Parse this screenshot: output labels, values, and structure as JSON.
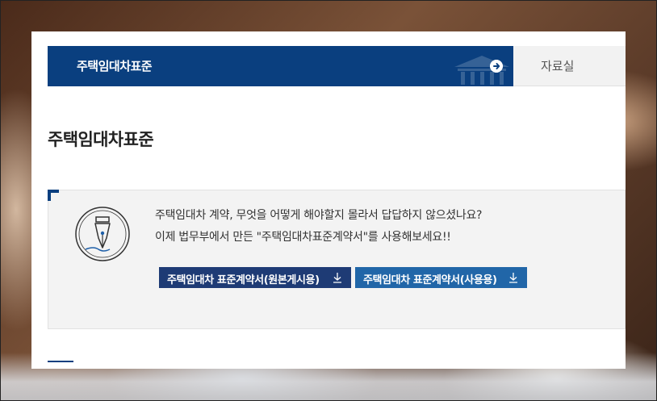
{
  "tabs": {
    "active_label": "주택임대차표준",
    "inactive_label": "자료실"
  },
  "page": {
    "title": "주택임대차표준"
  },
  "info": {
    "line1": "주택임대차 계약, 무엇을 어떻게 해야할지 몰라서 답답하지 않으셨나요?",
    "line2": "이제 법무부에서 만든 \"주택임대차표준계약서\"를 사용해보세요!!"
  },
  "downloads": {
    "original_label": "주택임대차 표준계약서(원본게시용)",
    "user_label": "주택임대차 표준계약서(사용용)"
  },
  "icons": {
    "arrow": "arrow-right-circle-icon",
    "bank": "bank-building-icon",
    "pen": "fountain-pen-icon",
    "download": "download-icon"
  },
  "colors": {
    "primary": "#0a3f7f",
    "button_original": "#1e3b75",
    "button_user": "#2166a8"
  }
}
